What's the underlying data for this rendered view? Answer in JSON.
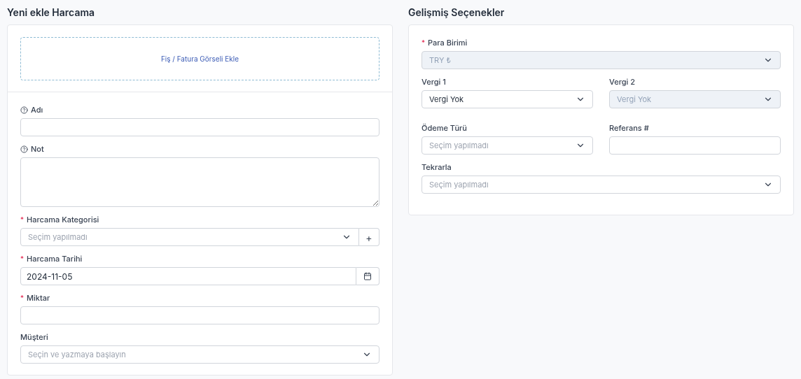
{
  "expense_form": {
    "title": "Yeni ekle Harcama",
    "upload": {
      "label": "Fiş / Fatura Görseli Ekle"
    },
    "fields": [
      {
        "kind": "text",
        "label": "Adı",
        "help": true
      },
      {
        "kind": "textarea",
        "label": "Not",
        "help": true
      },
      {
        "kind": "select",
        "label": "Harcama Kategorisi",
        "help": false,
        "required_mark": "*",
        "placeholder": "Seçim yapılmadı",
        "add_button": "+"
      },
      {
        "kind": "date",
        "label": "Harcama Tarihi",
        "help": false,
        "required_mark": "*",
        "value": "2024-11-05"
      },
      {
        "kind": "text",
        "label": "Miktar",
        "help": false,
        "required_mark": "*"
      },
      {
        "kind": "select",
        "label": "Müşteri",
        "help": false,
        "placeholder": "Seçin ve yazmaya başlayın"
      }
    ]
  },
  "advanced_options": {
    "title": "Gelişmiş Seçenekler",
    "rows": [
      {
        "fields": [
          {
            "kind": "select",
            "label": "Para Birimi",
            "required_mark": "*",
            "disabled": true,
            "value": "TRY ₺"
          }
        ]
      },
      {
        "fields": [
          {
            "kind": "select",
            "label": "Vergi 1",
            "disabled": false,
            "value": "Vergi Yok"
          },
          {
            "kind": "select",
            "label": "Vergi 2",
            "disabled": true,
            "value": "Vergi Yok"
          }
        ]
      },
      {
        "fields": [
          {
            "kind": "select",
            "label": "Ödeme Türü",
            "disabled": false,
            "placeholder": "Seçim yapılmadı"
          },
          {
            "kind": "text",
            "label": "Referans #",
            "disabled": false
          }
        ]
      },
      {
        "fields": [
          {
            "kind": "select",
            "label": "Tekrarla",
            "disabled": false,
            "placeholder": "Seçim yapılmadı"
          }
        ]
      }
    ]
  }
}
